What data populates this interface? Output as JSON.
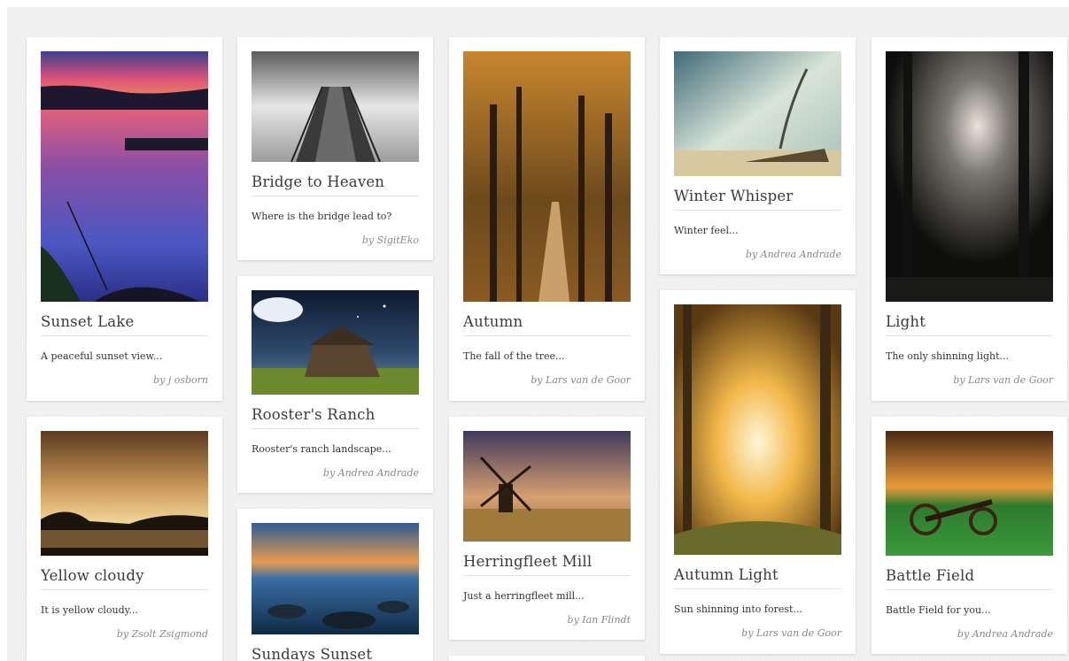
{
  "cards": {
    "sunset_lake": {
      "title": "Sunset Lake",
      "desc": "A peaceful sunset view...",
      "author": "by j osborn"
    },
    "bridge": {
      "title": "Bridge to Heaven",
      "desc": "Where is the bridge lead to?",
      "author": "by SigitEko"
    },
    "autumn": {
      "title": "Autumn",
      "desc": "The fall of the tree...",
      "author": "by Lars van de Goor"
    },
    "winter": {
      "title": "Winter Whisper",
      "desc": "Winter feel...",
      "author": "by Andrea Andrade"
    },
    "light": {
      "title": "Light",
      "desc": "The only shinning light...",
      "author": "by Lars van de Goor"
    },
    "rooster": {
      "title": "Rooster's Ranch",
      "desc": "Rooster's ranch landscape...",
      "author": "by Andrea Andrade"
    },
    "yellow": {
      "title": "Yellow cloudy",
      "desc": "It is yellow cloudy...",
      "author": "by Zsolt Zsigmond"
    },
    "herringfleet": {
      "title": "Herringfleet Mill",
      "desc": "Just a herringfleet mill...",
      "author": "by Ian Flindt"
    },
    "autumn_light": {
      "title": "Autumn Light",
      "desc": "Sun shinning into forest...",
      "author": "by Lars van de Goor"
    },
    "battle": {
      "title": "Battle Field",
      "desc": "Battle Field for you...",
      "author": "by Andrea Andrade"
    },
    "sundays": {
      "title": "Sundays Sunset"
    }
  }
}
